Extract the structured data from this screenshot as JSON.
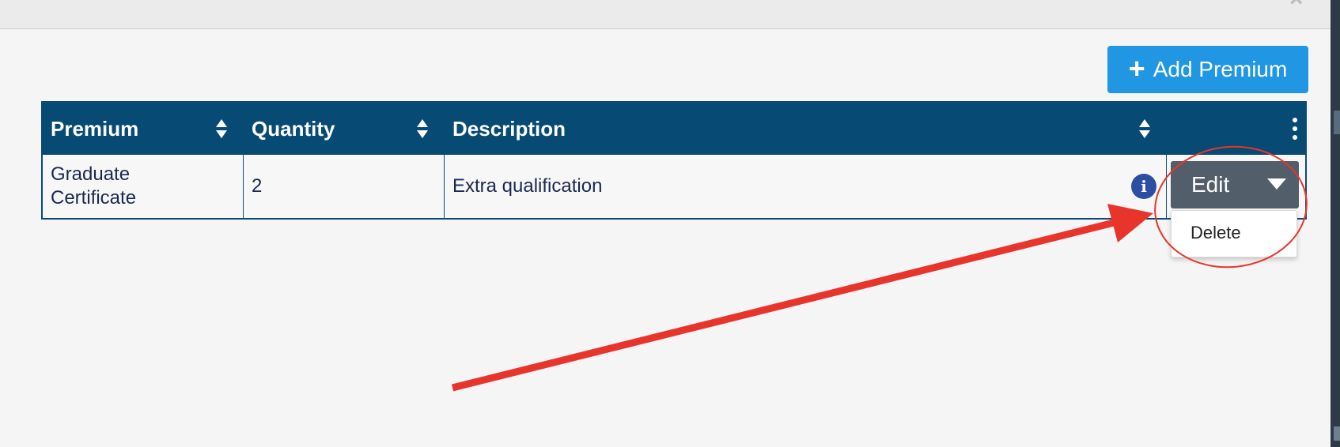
{
  "modal": {
    "close_glyph": "×"
  },
  "toolbar": {
    "add_label": "Add Premium",
    "add_icon": "plus-icon"
  },
  "table": {
    "headers": [
      "Premium",
      "Quantity",
      "Description"
    ],
    "rows": [
      {
        "premium": "Graduate Certificate",
        "quantity": "2",
        "description": "Extra qualification"
      }
    ]
  },
  "row_actions": {
    "edit_label": "Edit",
    "menu_items": [
      "Delete"
    ]
  },
  "annotation": {
    "color": "#e8352b",
    "shapes": [
      "arrow",
      "ellipse"
    ]
  },
  "colors": {
    "header_bg": "#074a73",
    "add_button": "#2196e3",
    "edit_button": "#535e6b",
    "info_icon": "#2c4fa3"
  }
}
